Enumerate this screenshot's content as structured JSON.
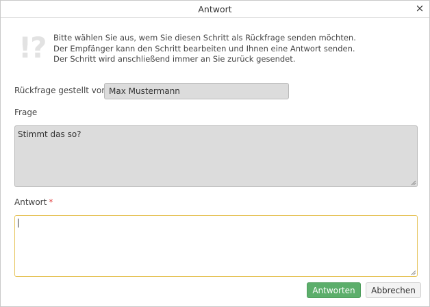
{
  "dialog": {
    "title": "Antwort",
    "close_glyph": "×",
    "close_icon": "close-icon"
  },
  "info": {
    "icon": "exclamation-question-icon",
    "icon_glyph": "!?",
    "lines": [
      "Bitte wählen Sie aus, wem Sie diesen Schritt als Rückfrage senden möchten.",
      "Der Empfänger kann den Schritt bearbeiten und Ihnen eine Antwort senden.",
      "Der Schritt wird anschließend immer an Sie zurück gesendet."
    ]
  },
  "form": {
    "from_label": "Rückfrage gestellt von",
    "from_value": "Max Mustermann",
    "question_label": "Frage",
    "question_value": "Stimmt das so?",
    "answer_label": "Antwort",
    "answer_required_mark": "*",
    "answer_value": ""
  },
  "buttons": {
    "answer_label": "Antworten",
    "cancel_label": "Abbrechen"
  },
  "colors": {
    "primary_button": "#5cae6b",
    "focus_border": "#e6c45a",
    "readonly_bg": "#dcdcdc",
    "required": "#e03a3a"
  }
}
